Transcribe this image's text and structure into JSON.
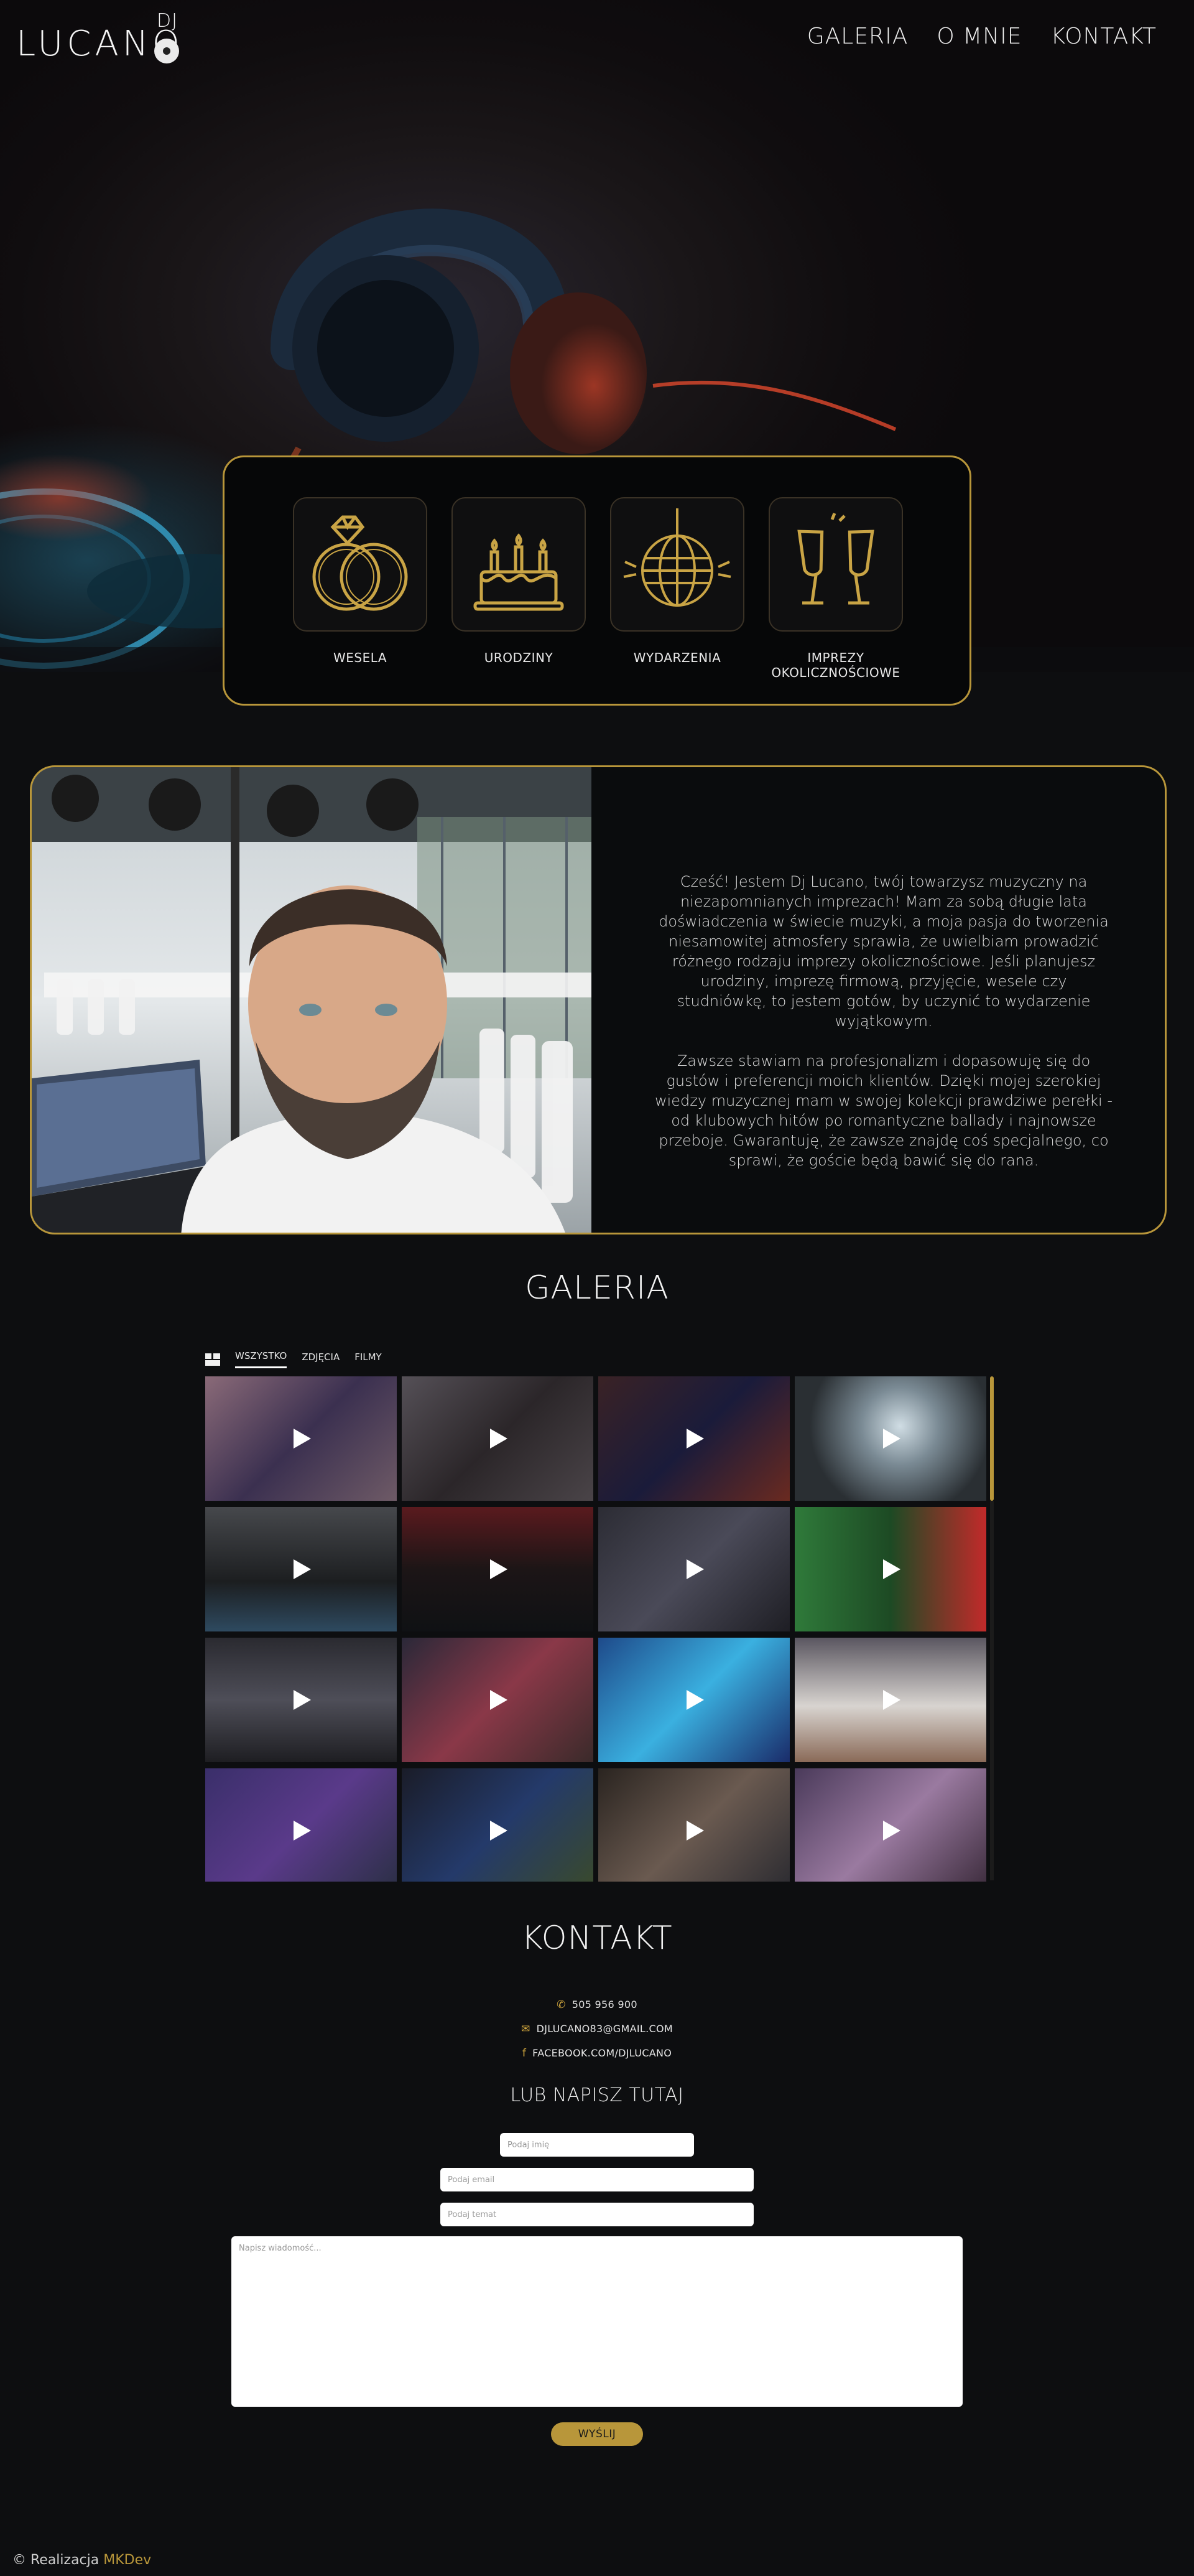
{
  "logo": {
    "dj": "DJ",
    "name": "LUCANO"
  },
  "nav": {
    "items": [
      "GALERIA",
      "O MNIE",
      "KONTAKT"
    ]
  },
  "services": [
    {
      "label": "WESELA",
      "icon": "rings-icon"
    },
    {
      "label": "URODZINY",
      "icon": "cake-icon"
    },
    {
      "label": "WYDARZENIA",
      "icon": "disco-ball-icon"
    },
    {
      "label": "IMPREZY OKOLICZNOŚCIOWE",
      "icon": "champagne-glasses-icon"
    }
  ],
  "about": {
    "paragraph1": "Cześć! Jestem Dj Lucano, twój towarzysz muzyczny na niezapomnianych imprezach! Mam za sobą długie lata doświadczenia w świecie muzyki, a moja pasja do tworzenia niesamowitej atmosfery sprawia, że uwielbiam prowadzić różnego rodzaju imprezy okolicznościowe. Jeśli planujesz urodziny, imprezę firmową, przyjęcie, wesele czy studniówkę, to jestem gotów, by uczynić to wydarzenie wyjątkowym.",
    "paragraph2": "Zawsze stawiam na profesjonalizm i dopasowuję się do gustów i preferencji moich klientów. Dzięki mojej szerokiej wiedzy muzycznej mam w swojej kolekcji prawdziwe perełki - od klubowych hitów po romantyczne ballady i najnowsze przeboje. Gwarantuję, że zawsze znajdę coś specjalnego, co sprawi, że goście będą bawić się do rana."
  },
  "gallery": {
    "title": "GALERIA",
    "filters": [
      "WSZYSTKO",
      "ZDJĘCIA",
      "FILMY"
    ],
    "active_filter": "WSZYSTKO"
  },
  "contact": {
    "title": "KONTAKT",
    "phone": "505 956 900",
    "email": "DJLUCANO83@GMAIL.COM",
    "facebook": "FACEBOOK.COM/DJLUCANO",
    "form_title": "LUB NAPISZ TUTAJ",
    "name_placeholder": "Podaj imię",
    "email_placeholder": "Podaj email",
    "subject_placeholder": "Podaj temat",
    "message_placeholder": "Napisz wiadomość...",
    "send_label": "WYŚLIJ"
  },
  "footer": {
    "prefix": "© Realizacja",
    "link": "MKDev"
  },
  "colors": {
    "accent": "#b8963a",
    "background": "#0d0e10"
  }
}
